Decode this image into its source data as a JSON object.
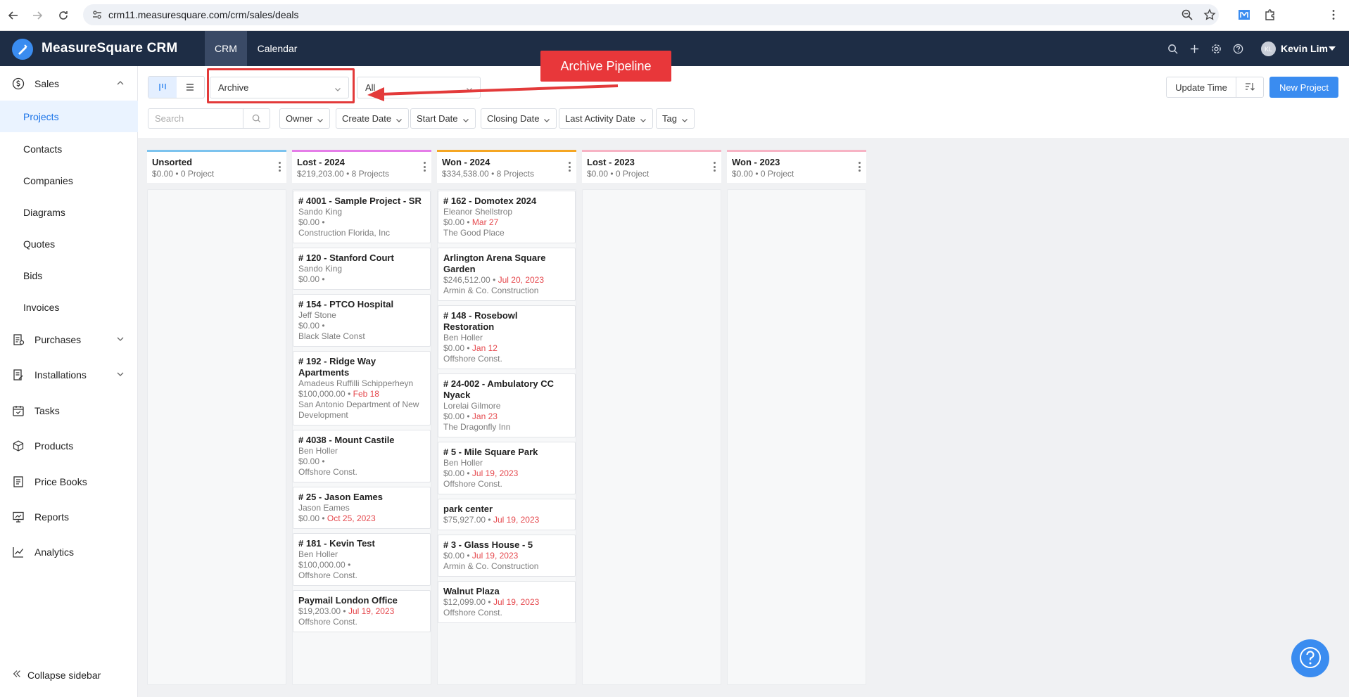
{
  "browser": {
    "url": "crm11.measuresquare.com/crm/sales/deals"
  },
  "header": {
    "brand": "MeasureSquare CRM",
    "tabs": [
      {
        "label": "CRM",
        "active": true
      },
      {
        "label": "Calendar",
        "active": false
      }
    ],
    "user": {
      "initials": "KL",
      "name": "Kevin Lim"
    }
  },
  "sidebar": {
    "groups": [
      {
        "label": "Sales",
        "icon": "dollar-circle-icon",
        "expanded": true
      },
      {
        "label": "Purchases",
        "icon": "receipt-icon",
        "expanded": false
      },
      {
        "label": "Installations",
        "icon": "installation-icon",
        "expanded": false
      },
      {
        "label": "Tasks",
        "icon": "calendar-check-icon"
      },
      {
        "label": "Products",
        "icon": "box-icon"
      },
      {
        "label": "Price Books",
        "icon": "book-icon"
      },
      {
        "label": "Reports",
        "icon": "presentation-icon"
      },
      {
        "label": "Analytics",
        "icon": "line-chart-icon"
      }
    ],
    "sales_items": [
      "Projects",
      "Contacts",
      "Companies",
      "Diagrams",
      "Quotes",
      "Bids",
      "Invoices"
    ],
    "active_item": "Projects",
    "collapse_label": "Collapse sidebar"
  },
  "toolbar": {
    "pipeline_value": "Archive",
    "stage_filter_value": "All",
    "search_placeholder": "Search",
    "filters": [
      "Owner",
      "Create Date",
      "Start Date",
      "Closing Date",
      "Last Activity Date",
      "Tag"
    ],
    "sort_label": "Update Time",
    "new_project_label": "New Project"
  },
  "annotation": {
    "callout_text": "Archive Pipeline",
    "color": "#e8373a"
  },
  "columns": [
    {
      "title": "Unsorted",
      "summary": "$0.00 • 0 Project",
      "color": "#7cc3ee",
      "cards": []
    },
    {
      "title": "Lost - 2024",
      "summary": "$219,203.00 • 8 Projects",
      "color": "#e57de8",
      "cards": [
        {
          "title": "# 4001 - Sample Project - SR",
          "contact": "Sando King",
          "amount": "$0.00 •",
          "date": "",
          "company": "Construction Florida, Inc"
        },
        {
          "title": "# 120 - Stanford Court",
          "contact": "Sando King",
          "amount": "$0.00 •",
          "date": "",
          "company": ""
        },
        {
          "title": "# 154 - PTCO Hospital",
          "contact": "Jeff Stone",
          "amount": "$0.00 •",
          "date": "",
          "company": "Black Slate Const"
        },
        {
          "title": "# 192 - Ridge Way Apartments",
          "contact": "Amadeus Ruffilli Schipperheyn",
          "amount": "$100,000.00 •",
          "date": "Feb 18",
          "company": "San Antonio Department of New Development"
        },
        {
          "title": "# 4038 - Mount Castile",
          "contact": "Ben Holler",
          "amount": "$0.00 •",
          "date": "",
          "company": "Offshore Const."
        },
        {
          "title": "# 25 - Jason Eames",
          "contact": "Jason Eames",
          "amount": "$0.00 •",
          "date": "Oct 25, 2023",
          "company": ""
        },
        {
          "title": "# 181 - Kevin Test",
          "contact": "Ben Holler",
          "amount": "$100,000.00 •",
          "date": "",
          "company": "Offshore Const."
        },
        {
          "title": "Paymail London Office",
          "contact": "",
          "amount": "$19,203.00 •",
          "date": "Jul 19, 2023",
          "company": "Offshore Const."
        }
      ]
    },
    {
      "title": "Won - 2024",
      "summary": "$334,538.00 • 8 Projects",
      "color": "#f5a623",
      "cards": [
        {
          "title": "# 162 - Domotex 2024",
          "contact": "Eleanor Shellstrop",
          "amount": "$0.00 •",
          "date": "Mar 27",
          "company": "The Good Place"
        },
        {
          "title": "Arlington Arena Square Garden",
          "contact": "",
          "amount": "$246,512.00 •",
          "date": "Jul 20, 2023",
          "company": "Armin & Co. Construction"
        },
        {
          "title": "# 148 - Rosebowl Restoration",
          "contact": "Ben Holler",
          "amount": "$0.00 •",
          "date": "Jan 12",
          "company": "Offshore Const."
        },
        {
          "title": "# 24-002 - Ambulatory CC Nyack",
          "contact": "Lorelai Gilmore",
          "amount": "$0.00 •",
          "date": "Jan 23",
          "company": "The Dragonfly Inn"
        },
        {
          "title": "# 5 - Mile Square Park",
          "contact": "Ben Holler",
          "amount": "$0.00 •",
          "date": "Jul 19, 2023",
          "company": "Offshore Const."
        },
        {
          "title": "park center",
          "contact": "",
          "amount": "$75,927.00 •",
          "date": "Jul 19, 2023",
          "company": ""
        },
        {
          "title": "# 3 - Glass House - 5",
          "contact": "",
          "amount": "$0.00 •",
          "date": "Jul 19, 2023",
          "company": "Armin & Co. Construction"
        },
        {
          "title": "Walnut Plaza",
          "contact": "",
          "amount": "$12,099.00 •",
          "date": "Jul 19, 2023",
          "company": "Offshore Const."
        }
      ]
    },
    {
      "title": "Lost - 2023",
      "summary": "$0.00 • 0 Project",
      "color": "#f7b3c4",
      "cards": []
    },
    {
      "title": "Won - 2023",
      "summary": "$0.00 • 0 Project",
      "color": "#f7b3c4",
      "cards": []
    }
  ]
}
